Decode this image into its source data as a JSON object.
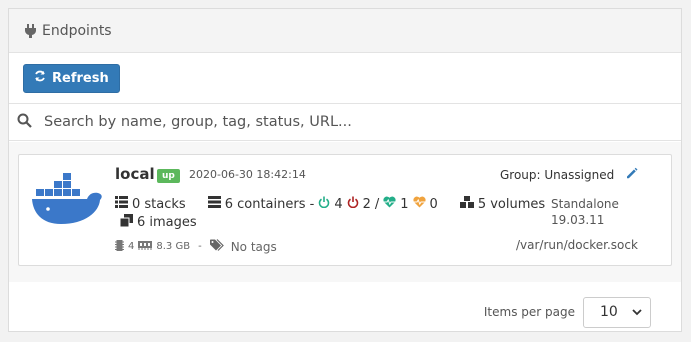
{
  "header": {
    "title": "Endpoints",
    "icon": "plug-icon"
  },
  "toolbar": {
    "refresh_label": "Refresh"
  },
  "search": {
    "placeholder": "Search by name, group, tag, status, URL..."
  },
  "endpoint": {
    "name": "local",
    "status": "up",
    "timestamp": "2020-06-30 18:42:14",
    "group": "Group: Unassigned",
    "stacks": "0 stacks",
    "containers": "6 containers -",
    "running": "4",
    "stopped": "2",
    "slash": "/",
    "healthy": "1",
    "unhealthy": "0",
    "volumes": "5 volumes",
    "images": "6 images",
    "type": "Standalone",
    "version": "19.03.11",
    "cpu": "4",
    "memory": "8.3 GB",
    "dash": "-",
    "tags": "No tags",
    "url": "/var/run/docker.sock"
  },
  "pagination": {
    "label": "Items per page",
    "value": "10"
  },
  "colors": {
    "primary": "#337ab7",
    "up": "#5cb85c",
    "running": "#23ae89",
    "stopped": "#ae2323",
    "unhealthy": "#f0a33e",
    "docker": "#3b78c9"
  }
}
